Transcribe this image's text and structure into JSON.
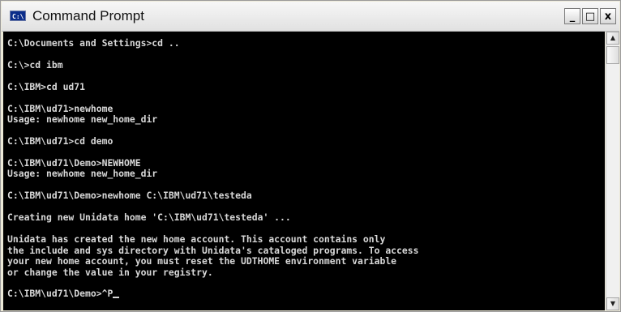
{
  "window": {
    "title": "Command Prompt",
    "icon_text": "C:\\",
    "minimize_label": "_",
    "maximize_label": "□",
    "close_label": "x"
  },
  "console": {
    "lines": [
      "C:\\Documents and Settings>cd ..",
      "",
      "C:\\>cd ibm",
      "",
      "C:\\IBM>cd ud71",
      "",
      "C:\\IBM\\ud71>newhome",
      "Usage: newhome new_home_dir",
      "",
      "C:\\IBM\\ud71>cd demo",
      "",
      "C:\\IBM\\ud71\\Demo>NEWHOME",
      "Usage: newhome new_home_dir",
      "",
      "C:\\IBM\\ud71\\Demo>newhome C:\\IBM\\ud71\\testeda",
      "",
      "Creating new Unidata home 'C:\\IBM\\ud71\\testeda' ...",
      "",
      "Unidata has created the new home account. This account contains only",
      "the include and sys directory with Unidata's cataloged programs. To access",
      "your new home account, you must reset the UDTHOME environment variable",
      "or change the value in your registry.",
      ""
    ],
    "prompt_line": "C:\\IBM\\ud71\\Demo>^P"
  },
  "scrollbar": {
    "up_arrow": "▲",
    "down_arrow": "▼"
  },
  "colors": {
    "console_bg": "#000000",
    "console_text": "#d8d8d8",
    "titlebar_bg": "#e8e8e8"
  }
}
